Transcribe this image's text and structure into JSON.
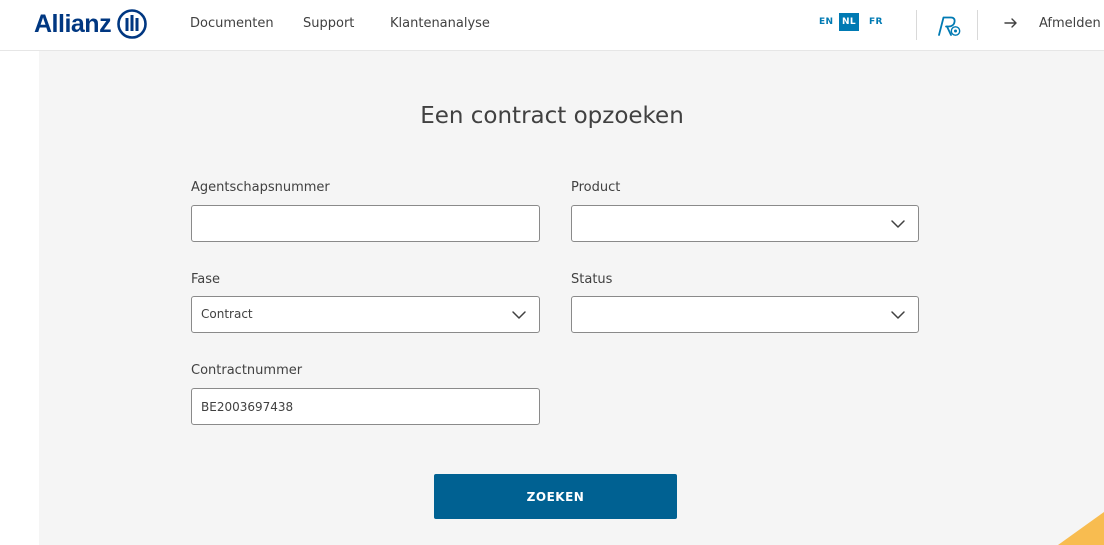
{
  "header": {
    "brand": "Allianz",
    "nav": [
      {
        "label": "Documenten"
      },
      {
        "label": "Support"
      },
      {
        "label": "Klantenanalyse"
      }
    ],
    "languages": [
      {
        "code": "EN",
        "active": false
      },
      {
        "code": "NL",
        "active": true
      },
      {
        "code": "FR",
        "active": false
      }
    ],
    "user_icon": "user-settings-icon",
    "logout": {
      "icon": "arrow-right-icon",
      "label": "Afmelden"
    }
  },
  "form": {
    "title": "Een contract opzoeken",
    "agency_number": {
      "label": "Agentschapsnummer",
      "value": ""
    },
    "product": {
      "label": "Product",
      "value": ""
    },
    "phase": {
      "label": "Fase",
      "value": "Contract"
    },
    "status": {
      "label": "Status",
      "value": ""
    },
    "contract_number": {
      "label": "Contractnummer",
      "value": "BE2003697438"
    },
    "search_button": "ZOEKEN"
  },
  "colors": {
    "brand": "#003781",
    "accent": "#007ab3",
    "button": "#006192",
    "background": "#f5f5f5",
    "corner_accent": "#f8b133"
  }
}
